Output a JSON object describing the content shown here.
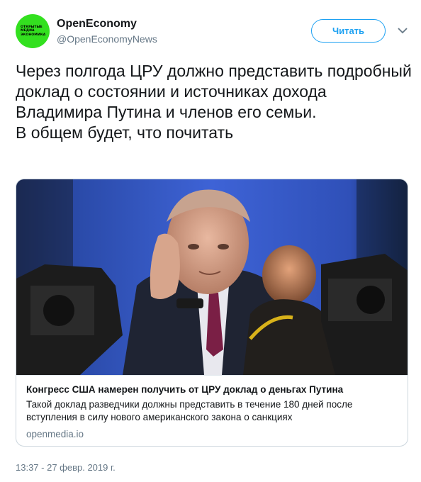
{
  "author": {
    "name": "OpenEconomy",
    "handle": "@OpenEconomyNews",
    "avatar_text": [
      "ОТКРЫТЫЕ",
      "МЕДИА",
      "ЭКОНОМИКА"
    ],
    "avatar_color": "#33e01f"
  },
  "follow_button": {
    "label": "Читать"
  },
  "menu_icon": "chevron-down-icon",
  "tweet": {
    "text": "Через полгода  ЦРУ должно представить подробный доклад о состоянии и источниках дохода Владимира Путина и членов его семьи.\nВ общем будет, что почитать"
  },
  "card": {
    "title": "Конгресс США намерен получить от ЦРУ доклад о деньгах Путина",
    "description": "Такой доклад разведчики должны представить в течение 180 дней после вступления в силу нового американского закона о санкциях",
    "domain": "openmedia.io"
  },
  "timestamp": "13:37 - 27 февр. 2019 г.",
  "colors": {
    "accent": "#1da1f2",
    "secondary_text": "#657786",
    "border": "#ccd6dd"
  }
}
